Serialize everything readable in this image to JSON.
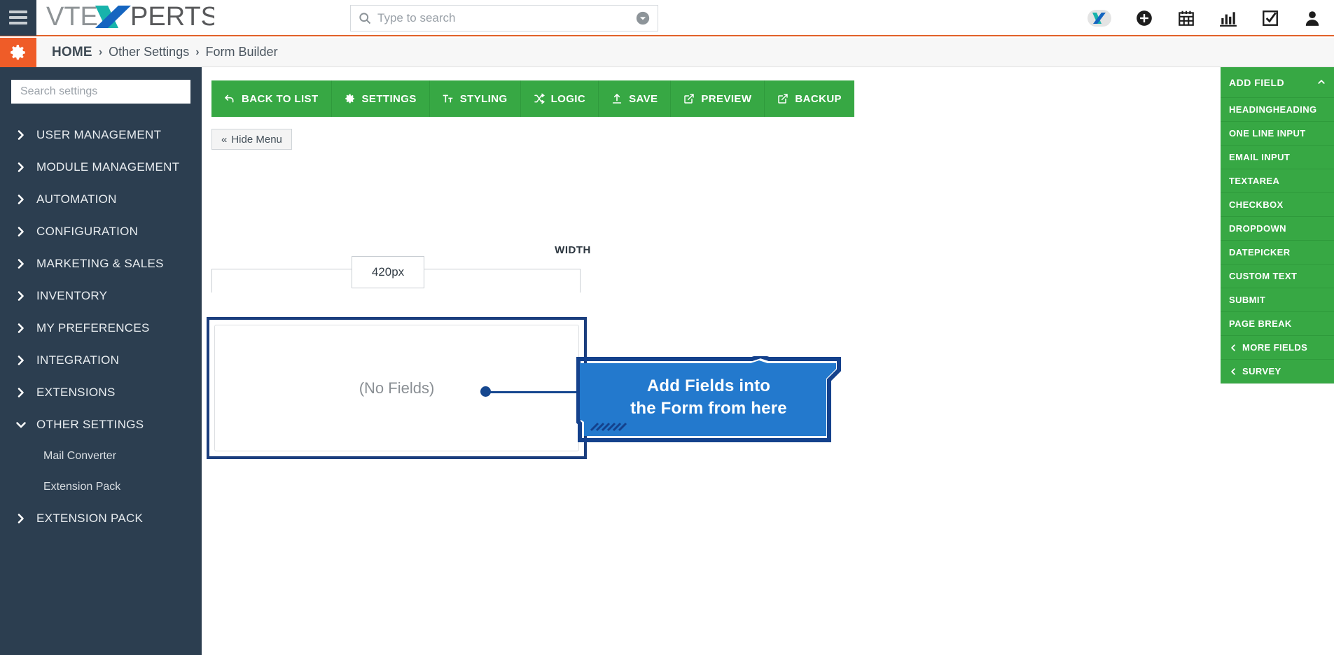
{
  "topbar": {
    "hamburger_icon": "hamburger-icon",
    "logo_text_a": "VTE",
    "logo_text_x": "X",
    "logo_text_b": "PERTS",
    "logo_alt": "VTExperts",
    "search": {
      "placeholder": "Type to search",
      "value": "",
      "search_icon": "search-icon",
      "chevron_icon": "chevron-down-circle-icon"
    },
    "icons": [
      {
        "name": "vtexperts-x-icon",
        "label": "X"
      },
      {
        "name": "add-circle-icon",
        "label": "Add"
      },
      {
        "name": "calendar-icon",
        "label": "Calendar"
      },
      {
        "name": "chart-icon",
        "label": "Reports"
      },
      {
        "name": "task-check-icon",
        "label": "Tasks"
      },
      {
        "name": "user-icon",
        "label": "User"
      }
    ]
  },
  "breadcrumb": {
    "gear_icon": "gear-icon",
    "home": "HOME",
    "separator": "›",
    "items": [
      "Other Settings",
      "Form Builder"
    ]
  },
  "sidebar": {
    "search_placeholder": "Search settings",
    "search_value": "",
    "items": [
      {
        "label": "USER MANAGEMENT",
        "expanded": false
      },
      {
        "label": "MODULE MANAGEMENT",
        "expanded": false
      },
      {
        "label": "AUTOMATION",
        "expanded": false
      },
      {
        "label": "CONFIGURATION",
        "expanded": false
      },
      {
        "label": "MARKETING & SALES",
        "expanded": false
      },
      {
        "label": "INVENTORY",
        "expanded": false
      },
      {
        "label": "MY PREFERENCES",
        "expanded": false
      },
      {
        "label": "INTEGRATION",
        "expanded": false
      },
      {
        "label": "EXTENSIONS",
        "expanded": false
      },
      {
        "label": "OTHER SETTINGS",
        "expanded": true
      },
      {
        "label": "EXTENSION PACK",
        "expanded": false
      }
    ],
    "sub_items": [
      "Mail Converter",
      "Extension Pack"
    ]
  },
  "toolbar": {
    "buttons": [
      {
        "label": "BACK TO LIST",
        "icon": "undo-arrow-icon"
      },
      {
        "label": "SETTINGS",
        "icon": "gear-icon"
      },
      {
        "label": "STYLING",
        "icon": "text-format-icon"
      },
      {
        "label": "LOGIC",
        "icon": "shuffle-icon"
      },
      {
        "label": "SAVE",
        "icon": "upload-icon"
      },
      {
        "label": "PREVIEW",
        "icon": "external-link-icon"
      },
      {
        "label": "BACKUP",
        "icon": "external-link-icon"
      }
    ],
    "hide_menu": "Hide Menu",
    "hide_menu_chevron": "«"
  },
  "form": {
    "width_label": "WIDTH",
    "width_value": "420px",
    "empty_text": "(No Fields)"
  },
  "callout": {
    "line1": "Add Fields into",
    "line2": "the Form from here",
    "color": "#2379cd",
    "border_color": "#14418c"
  },
  "right_panel": {
    "header": "ADD FIELD",
    "header_chevron": "chevron-up-icon",
    "fields": [
      "HEADINGHEADING",
      "ONE LINE INPUT",
      "EMAIL INPUT",
      "TEXTAREA",
      "CHECKBOX",
      "DROPDOWN",
      "DATEPICKER",
      "CUSTOM TEXT",
      "SUBMIT",
      "PAGE BREAK"
    ],
    "groups": [
      "MORE FIELDS",
      "SURVEY"
    ],
    "group_chevron": "‹"
  },
  "colors": {
    "green": "#37a844",
    "orange": "#ef5c28",
    "navy": "#2c3e50",
    "accent_blue": "#16478f"
  }
}
